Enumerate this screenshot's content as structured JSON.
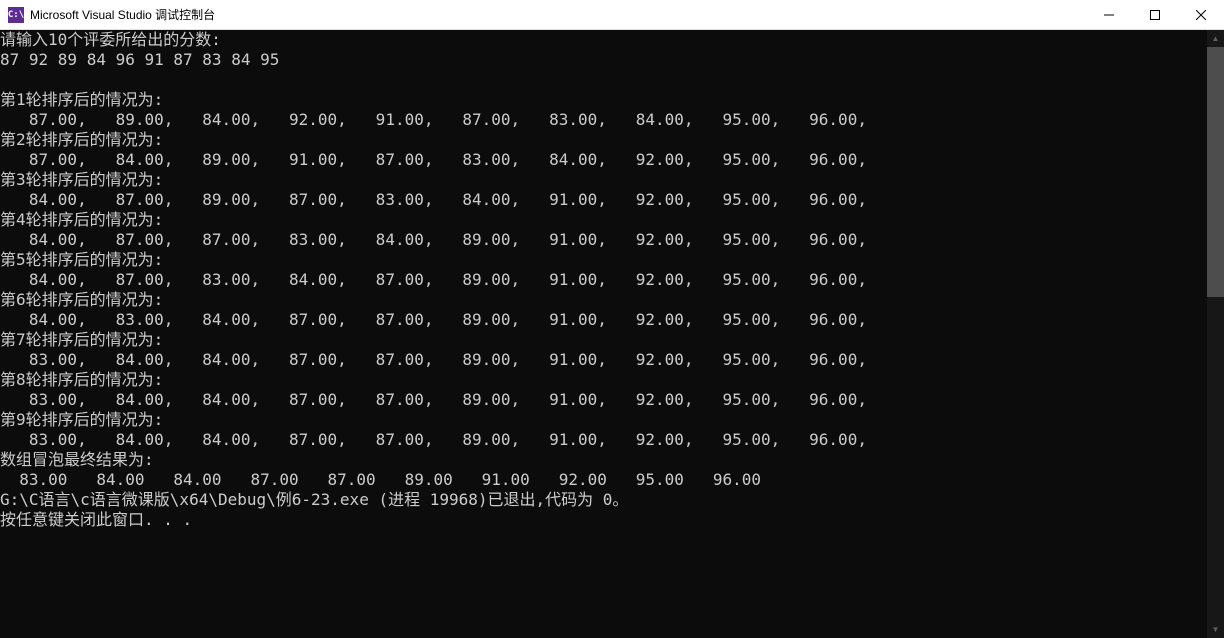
{
  "window": {
    "icon_text": "C:\\",
    "title": "Microsoft Visual Studio 调试控制台"
  },
  "console": {
    "prompt_line": "请输入10个评委所给出的分数:",
    "input_line": "87 92 89 84 96 91 87 83 84 95",
    "blank": "",
    "rounds": [
      {
        "label": "第1轮排序后的情况为:",
        "values": "   87.00,   89.00,   84.00,   92.00,   91.00,   87.00,   83.00,   84.00,   95.00,   96.00,"
      },
      {
        "label": "第2轮排序后的情况为:",
        "values": "   87.00,   84.00,   89.00,   91.00,   87.00,   83.00,   84.00,   92.00,   95.00,   96.00,"
      },
      {
        "label": "第3轮排序后的情况为:",
        "values": "   84.00,   87.00,   89.00,   87.00,   83.00,   84.00,   91.00,   92.00,   95.00,   96.00,"
      },
      {
        "label": "第4轮排序后的情况为:",
        "values": "   84.00,   87.00,   87.00,   83.00,   84.00,   89.00,   91.00,   92.00,   95.00,   96.00,"
      },
      {
        "label": "第5轮排序后的情况为:",
        "values": "   84.00,   87.00,   83.00,   84.00,   87.00,   89.00,   91.00,   92.00,   95.00,   96.00,"
      },
      {
        "label": "第6轮排序后的情况为:",
        "values": "   84.00,   83.00,   84.00,   87.00,   87.00,   89.00,   91.00,   92.00,   95.00,   96.00,"
      },
      {
        "label": "第7轮排序后的情况为:",
        "values": "   83.00,   84.00,   84.00,   87.00,   87.00,   89.00,   91.00,   92.00,   95.00,   96.00,"
      },
      {
        "label": "第8轮排序后的情况为:",
        "values": "   83.00,   84.00,   84.00,   87.00,   87.00,   89.00,   91.00,   92.00,   95.00,   96.00,"
      },
      {
        "label": "第9轮排序后的情况为:",
        "values": "   83.00,   84.00,   84.00,   87.00,   87.00,   89.00,   91.00,   92.00,   95.00,   96.00,"
      }
    ],
    "final_label": "数组冒泡最终结果为:",
    "final_values": "  83.00   84.00   84.00   87.00   87.00   89.00   91.00   92.00   95.00   96.00",
    "exit_line": "G:\\C语言\\c语言微课版\\x64\\Debug\\例6-23.exe (进程 19968)已退出,代码为 0。",
    "press_key": "按任意键关闭此窗口. . ."
  }
}
